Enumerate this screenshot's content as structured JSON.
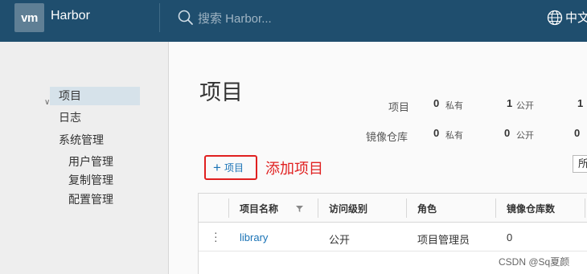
{
  "header": {
    "logo": "vm",
    "brand": "Harbor",
    "search_placeholder": "搜索 Harbor...",
    "language": "中文"
  },
  "sidebar": {
    "items": [
      {
        "label": "项目",
        "active": true
      },
      {
        "label": "日志"
      },
      {
        "label": "系统管理",
        "expanded": true
      }
    ],
    "sub_items": [
      "用户管理",
      "复制管理",
      "配置管理"
    ]
  },
  "page": {
    "title": "项目",
    "stats": {
      "projects": {
        "label": "项目",
        "private_count": "0",
        "private_label": "私有",
        "public_count": "1",
        "public_label": "公开",
        "total_count": "1"
      },
      "repos": {
        "label": "镜像仓库",
        "private_count": "0",
        "private_label": "私有",
        "public_count": "0",
        "public_label": "公开",
        "total_count": "0"
      }
    },
    "new_project_button": "项目",
    "annotation": "添加项目",
    "filter_value": "所"
  },
  "table": {
    "columns": [
      "项目名称",
      "访问级别",
      "角色",
      "镜像仓库数"
    ],
    "rows": [
      {
        "name": "library",
        "access": "公开",
        "role": "项目管理员",
        "repo_count": "0"
      }
    ]
  },
  "watermark": "CSDN @Sq夏颜",
  "colors": {
    "header_bg": "#1f4e6e",
    "link": "#1a73b6",
    "annotation_red": "#e02020"
  }
}
